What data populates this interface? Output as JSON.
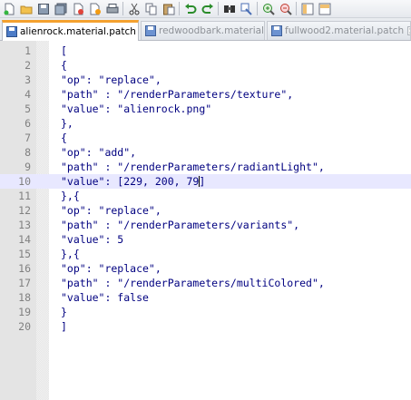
{
  "toolbar": {
    "buttons": [
      "new-file",
      "open-file",
      "save",
      "save-all",
      "close",
      "close-all",
      "print",
      "cut",
      "copy",
      "paste",
      "undo",
      "redo",
      "find",
      "replace",
      "zoom-in",
      "zoom-out",
      "sync-vertical",
      "sync-horizontal"
    ]
  },
  "tabs": [
    {
      "label": "alienrock.material.patch",
      "active": true
    },
    {
      "label": "redwoodbark.material",
      "active": false
    },
    {
      "label": "fullwood2.material.patch",
      "active": false
    }
  ],
  "editor": {
    "current_line": 10,
    "lines": [
      {
        "num": "1",
        "text": "["
      },
      {
        "num": "2",
        "text": "{"
      },
      {
        "num": "3",
        "text": "\"op\": \"replace\","
      },
      {
        "num": "4",
        "text": "\"path\" : \"/renderParameters/texture\","
      },
      {
        "num": "5",
        "text": "\"value\": \"alienrock.png\""
      },
      {
        "num": "6",
        "text": "},"
      },
      {
        "num": "7",
        "text": "{"
      },
      {
        "num": "8",
        "text": "\"op\": \"add\","
      },
      {
        "num": "9",
        "text": "\"path\" : \"/renderParameters/radiantLight\","
      },
      {
        "num": "10",
        "text": "\"value\": [229, 200, 79]"
      },
      {
        "num": "11",
        "text": "},{"
      },
      {
        "num": "12",
        "text": "\"op\": \"replace\","
      },
      {
        "num": "13",
        "text": "\"path\" : \"/renderParameters/variants\","
      },
      {
        "num": "14",
        "text": "\"value\": 5"
      },
      {
        "num": "15",
        "text": "},{"
      },
      {
        "num": "16",
        "text": "\"op\": \"replace\","
      },
      {
        "num": "17",
        "text": "\"path\" : \"/renderParameters/multiColored\","
      },
      {
        "num": "18",
        "text": "\"value\": false"
      },
      {
        "num": "19",
        "text": "}"
      },
      {
        "num": "20",
        "text": "]"
      }
    ]
  },
  "colors": {
    "code_text": "#000080",
    "current_line": "#e8e8ff",
    "active_tab_accent": "#f4a12f",
    "inactive_tab_text": "#8d9197",
    "line_number": "#808080"
  }
}
